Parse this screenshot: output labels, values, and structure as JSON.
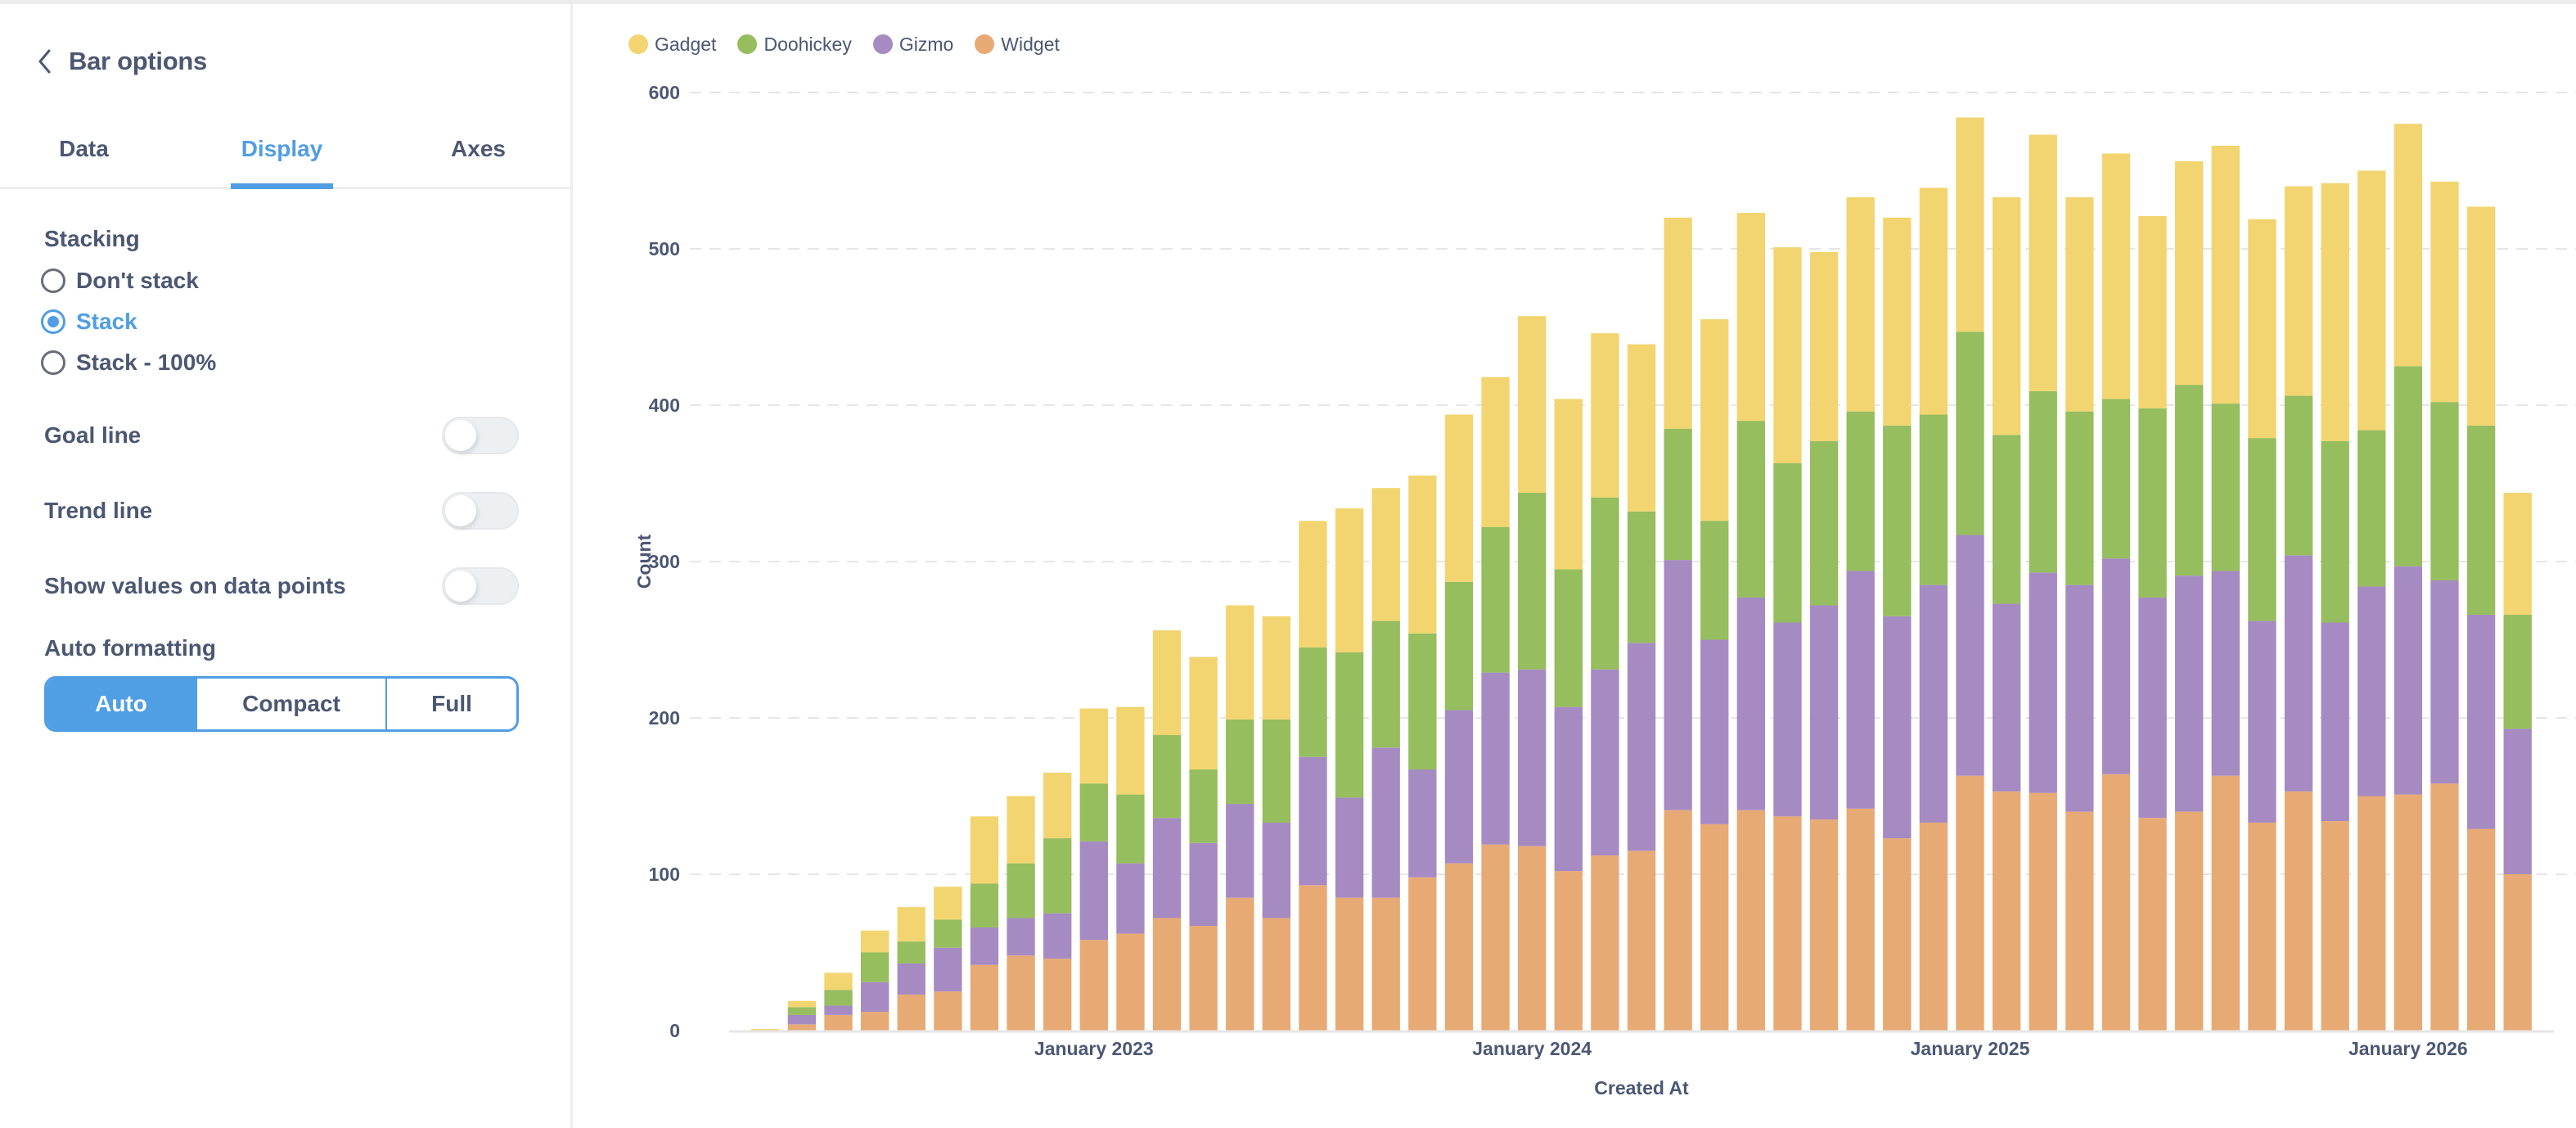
{
  "panel": {
    "title": "Bar options",
    "back_icon": "chevron-left-icon",
    "tabs": [
      {
        "label": "Data",
        "active": false
      },
      {
        "label": "Display",
        "active": true
      },
      {
        "label": "Axes",
        "active": false
      }
    ],
    "stacking": {
      "label": "Stacking",
      "options": [
        {
          "label": "Don't stack",
          "selected": false
        },
        {
          "label": "Stack",
          "selected": true
        },
        {
          "label": "Stack - 100%",
          "selected": false
        }
      ]
    },
    "toggles": [
      {
        "label": "Goal line",
        "on": false
      },
      {
        "label": "Trend line",
        "on": false
      },
      {
        "label": "Show values on data points",
        "on": false
      }
    ],
    "auto_formatting": {
      "label": "Auto formatting",
      "options": [
        {
          "label": "Auto",
          "selected": true
        },
        {
          "label": "Compact",
          "selected": false
        },
        {
          "label": "Full",
          "selected": false
        }
      ]
    }
  },
  "colors": {
    "accent": "#509ee3",
    "text": "#4c5773",
    "Gadget": "#f2d570",
    "Doohickey": "#96bd5e",
    "Gizmo": "#a68bc2",
    "Widget": "#e7aa75",
    "grid": "#e6e6e6"
  },
  "chart_data": {
    "type": "bar",
    "stacked": true,
    "title": "",
    "xlabel": "Created At",
    "ylabel": "Count",
    "ylim": [
      0,
      600
    ],
    "yticks": [
      0,
      100,
      200,
      300,
      400,
      500,
      600
    ],
    "grid": true,
    "legend": "top-left",
    "x_tick_labels": [
      {
        "category": "2023-01",
        "label": "January 2023"
      },
      {
        "category": "2024-01",
        "label": "January 2024"
      },
      {
        "category": "2025-01",
        "label": "January 2025"
      },
      {
        "category": "2026-01",
        "label": "January 2026"
      }
    ],
    "categories": [
      "2022-04",
      "2022-05",
      "2022-06",
      "2022-07",
      "2022-08",
      "2022-09",
      "2022-10",
      "2022-11",
      "2022-12",
      "2023-01",
      "2023-02",
      "2023-03",
      "2023-04",
      "2023-05",
      "2023-06",
      "2023-07",
      "2023-08",
      "2023-09",
      "2023-10",
      "2023-11",
      "2023-12",
      "2024-01",
      "2024-02",
      "2024-03",
      "2024-04",
      "2024-05",
      "2024-06",
      "2024-07",
      "2024-08",
      "2024-09",
      "2024-10",
      "2024-11",
      "2024-12",
      "2025-01",
      "2025-02",
      "2025-03",
      "2025-04",
      "2025-05",
      "2025-06",
      "2025-07",
      "2025-08",
      "2025-09",
      "2025-10",
      "2025-11",
      "2025-12",
      "2026-01",
      "2026-02",
      "2026-03",
      "2026-04"
    ],
    "series": [
      {
        "name": "Widget",
        "values": [
          0,
          4,
          10,
          12,
          23,
          25,
          42,
          48,
          46,
          58,
          62,
          72,
          67,
          85,
          72,
          93,
          85,
          85,
          98,
          107,
          119,
          118,
          102,
          112,
          115,
          141,
          132,
          141,
          137,
          135,
          142,
          123,
          133,
          163,
          153,
          152,
          140,
          164,
          136,
          140,
          163,
          133,
          153,
          134,
          150,
          151,
          158,
          129,
          100
        ]
      },
      {
        "name": "Gizmo",
        "values": [
          0,
          6,
          6,
          19,
          20,
          28,
          24,
          24,
          29,
          63,
          45,
          64,
          53,
          60,
          61,
          82,
          64,
          96,
          69,
          98,
          110,
          113,
          105,
          119,
          133,
          160,
          118,
          136,
          124,
          137,
          152,
          142,
          152,
          154,
          120,
          141,
          145,
          138,
          141,
          151,
          131,
          129,
          151,
          127,
          134,
          146,
          130,
          137,
          93
        ]
      },
      {
        "name": "Doohickey",
        "values": [
          0,
          5,
          10,
          19,
          14,
          18,
          28,
          35,
          48,
          37,
          44,
          53,
          47,
          54,
          66,
          70,
          93,
          81,
          87,
          82,
          93,
          113,
          88,
          110,
          84,
          84,
          76,
          113,
          102,
          105,
          102,
          122,
          109,
          130,
          108,
          116,
          111,
          102,
          121,
          122,
          107,
          117,
          102,
          116,
          100,
          128,
          114,
          121,
          73
        ]
      },
      {
        "name": "Gadget",
        "values": [
          1,
          4,
          11,
          14,
          22,
          21,
          43,
          43,
          42,
          48,
          56,
          67,
          72,
          73,
          66,
          81,
          92,
          85,
          101,
          107,
          96,
          113,
          109,
          105,
          107,
          135,
          129,
          133,
          138,
          121,
          137,
          133,
          145,
          137,
          152,
          164,
          137,
          157,
          123,
          143,
          165,
          140,
          134,
          165,
          166,
          155,
          141,
          140,
          78
        ]
      }
    ],
    "legend_order": [
      "Gadget",
      "Doohickey",
      "Gizmo",
      "Widget"
    ]
  }
}
